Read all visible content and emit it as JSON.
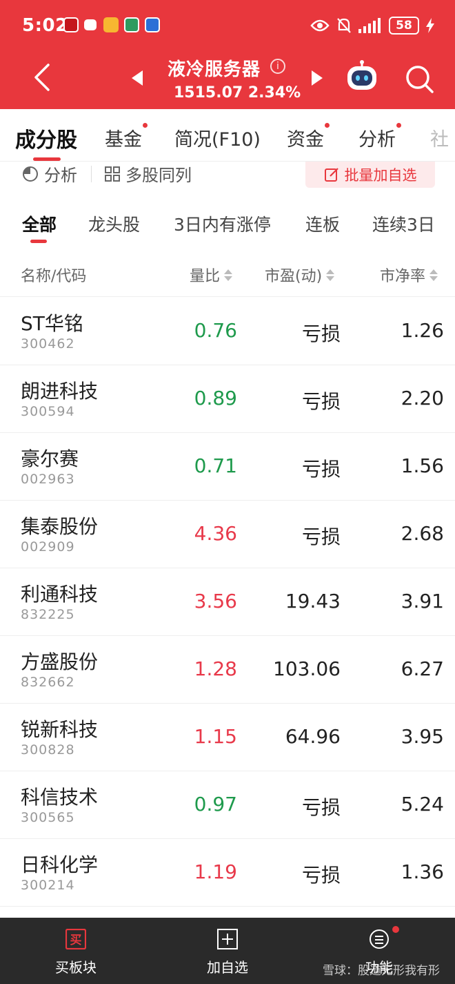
{
  "status_bar": {
    "time": "5:02",
    "battery": "58"
  },
  "header": {
    "title": "液冷服务器",
    "quote": "1515.07  2.34%"
  },
  "tabs": [
    {
      "label": "成分股",
      "dot": false
    },
    {
      "label": "基金",
      "dot": true
    },
    {
      "label": "简况(F10)",
      "dot": false
    },
    {
      "label": "资金",
      "dot": true
    },
    {
      "label": "分析",
      "dot": true
    },
    {
      "label": "社",
      "dot": false
    }
  ],
  "tools": {
    "analysis": "分析",
    "multi": "多股同列",
    "batch_add": "批量加自选"
  },
  "filters": [
    "全部",
    "龙头股",
    "3日内有涨停",
    "连板",
    "连续3日"
  ],
  "columns": {
    "name": "名称/代码",
    "ratio": "量比",
    "pe": "市盈(动)",
    "pb": "市净率"
  },
  "colors": {
    "up": "#e8394a",
    "down": "#1e9a4c",
    "brand": "#e8373d"
  },
  "rows": [
    {
      "name": "ST华铭",
      "code": "300462",
      "ratio": "0.76",
      "dir": "down",
      "pe": "亏损",
      "pb": "1.26"
    },
    {
      "name": "朗进科技",
      "code": "300594",
      "ratio": "0.89",
      "dir": "down",
      "pe": "亏损",
      "pb": "2.20"
    },
    {
      "name": "豪尔赛",
      "code": "002963",
      "ratio": "0.71",
      "dir": "down",
      "pe": "亏损",
      "pb": "1.56"
    },
    {
      "name": "集泰股份",
      "code": "002909",
      "ratio": "4.36",
      "dir": "up",
      "pe": "亏损",
      "pb": "2.68"
    },
    {
      "name": "利通科技",
      "code": "832225",
      "ratio": "3.56",
      "dir": "up",
      "pe": "19.43",
      "pb": "3.91"
    },
    {
      "name": "方盛股份",
      "code": "832662",
      "ratio": "1.28",
      "dir": "up",
      "pe": "103.06",
      "pb": "6.27"
    },
    {
      "name": "锐新科技",
      "code": "300828",
      "ratio": "1.15",
      "dir": "up",
      "pe": "64.96",
      "pb": "3.95"
    },
    {
      "name": "科信技术",
      "code": "300565",
      "ratio": "0.97",
      "dir": "down",
      "pe": "亏损",
      "pb": "5.24"
    },
    {
      "name": "日科化学",
      "code": "300214",
      "ratio": "1.19",
      "dir": "up",
      "pe": "亏损",
      "pb": "1.36"
    }
  ],
  "bottom_bar": {
    "buy_icon_char": "买",
    "buy": "买板块",
    "add": "加自选",
    "func": "功能",
    "watermark": "雪球：股道无形我有形"
  }
}
